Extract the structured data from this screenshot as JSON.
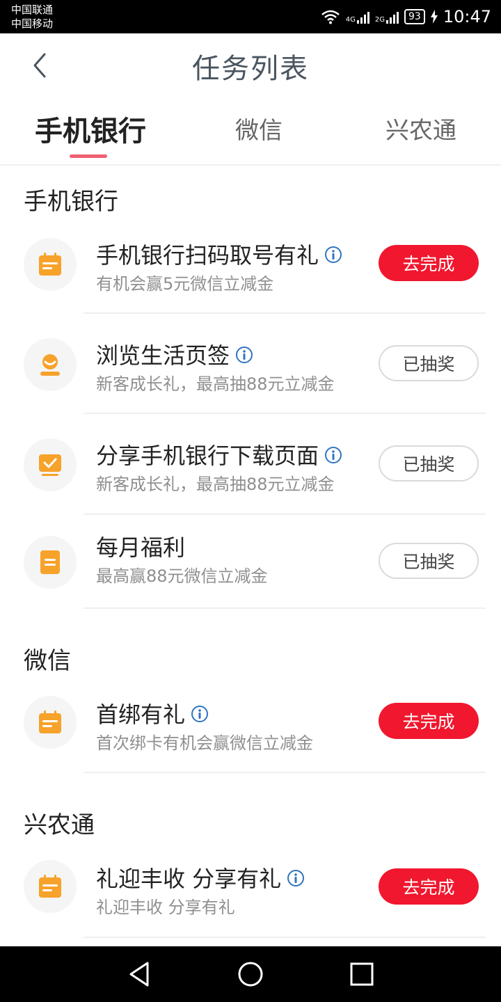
{
  "status_bar": {
    "carrier1": "中国联通",
    "carrier2": "中国移动",
    "net1": "4G",
    "net2": "2G",
    "battery": "93",
    "time": "10:47"
  },
  "header": {
    "title": "任务列表"
  },
  "tabs": [
    {
      "label": "手机银行",
      "active": true
    },
    {
      "label": "微信",
      "active": false
    },
    {
      "label": "兴农通",
      "active": false
    }
  ],
  "sections": [
    {
      "title": "手机银行",
      "items": [
        {
          "title": "手机银行扫码取号有礼",
          "subtitle": "有机会赢5元微信立减金",
          "button": "去完成",
          "icon": "calendar-icon",
          "info": true
        },
        {
          "title": "浏览生活页签",
          "subtitle": "新客成长礼，最高抽88元立减金",
          "button": "已抽奖",
          "icon": "person-icon",
          "info": true
        },
        {
          "title": "分享手机银行下载页面",
          "subtitle": "新客成长礼，最高抽88元立减金",
          "button": "已抽奖",
          "icon": "monitor-check-icon",
          "info": true
        },
        {
          "title": "每月福利",
          "subtitle": "最高赢88元微信立减金",
          "button": "已抽奖",
          "icon": "document-icon",
          "info": false
        }
      ]
    },
    {
      "title": "微信",
      "items": [
        {
          "title": "首绑有礼",
          "subtitle": "首次绑卡有机会赢微信立减金",
          "button": "去完成",
          "icon": "calendar-icon",
          "info": true
        }
      ]
    },
    {
      "title": "兴农通",
      "items": [
        {
          "title": "礼迎丰收 分享有礼",
          "subtitle": "礼迎丰收 分享有礼",
          "button": "去完成",
          "icon": "calendar-icon",
          "info": true
        }
      ]
    }
  ],
  "colors": {
    "accent_red": "#f0172e",
    "icon_orange": "#f7a22a",
    "tab_indicator": "#f06070",
    "info_blue": "#2f74c0"
  }
}
